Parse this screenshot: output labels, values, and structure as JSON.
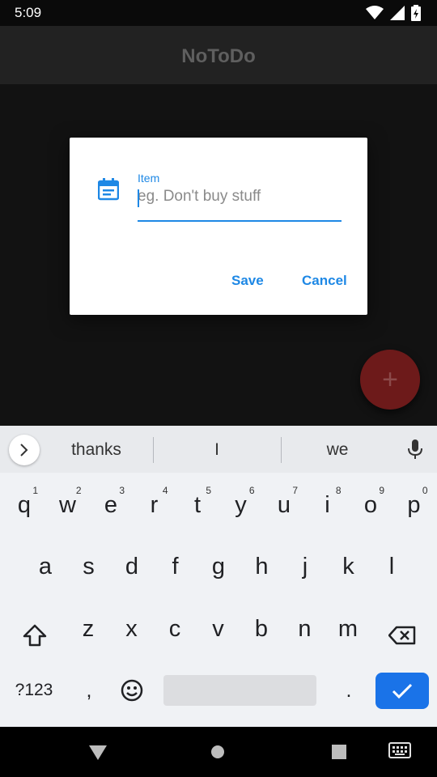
{
  "status_bar": {
    "time": "5:09",
    "icons": [
      "wifi-icon",
      "signal-icon",
      "battery-charging-icon"
    ]
  },
  "app_bar": {
    "title": "NoToDo"
  },
  "dialog": {
    "icon": "calendar-note-icon",
    "field_label": "Item",
    "field_placeholder": "eg. Don't buy stuff",
    "field_value": "",
    "save_label": "Save",
    "cancel_label": "Cancel"
  },
  "fab": {
    "label": "+"
  },
  "keyboard": {
    "suggestions": [
      "thanks",
      "I",
      "we"
    ],
    "row1": [
      {
        "k": "q",
        "n": "1"
      },
      {
        "k": "w",
        "n": "2"
      },
      {
        "k": "e",
        "n": "3"
      },
      {
        "k": "r",
        "n": "4"
      },
      {
        "k": "t",
        "n": "5"
      },
      {
        "k": "y",
        "n": "6"
      },
      {
        "k": "u",
        "n": "7"
      },
      {
        "k": "i",
        "n": "8"
      },
      {
        "k": "o",
        "n": "9"
      },
      {
        "k": "p",
        "n": "0"
      }
    ],
    "row2": [
      "a",
      "s",
      "d",
      "f",
      "g",
      "h",
      "j",
      "k",
      "l"
    ],
    "row3": [
      "z",
      "x",
      "c",
      "v",
      "b",
      "n",
      "m"
    ],
    "symbols_label": "?123",
    "comma": ",",
    "period": "."
  },
  "colors": {
    "accent": "#1e88e5",
    "fab": "#6d1a1a",
    "keyboard_enter": "#1a73e8"
  }
}
